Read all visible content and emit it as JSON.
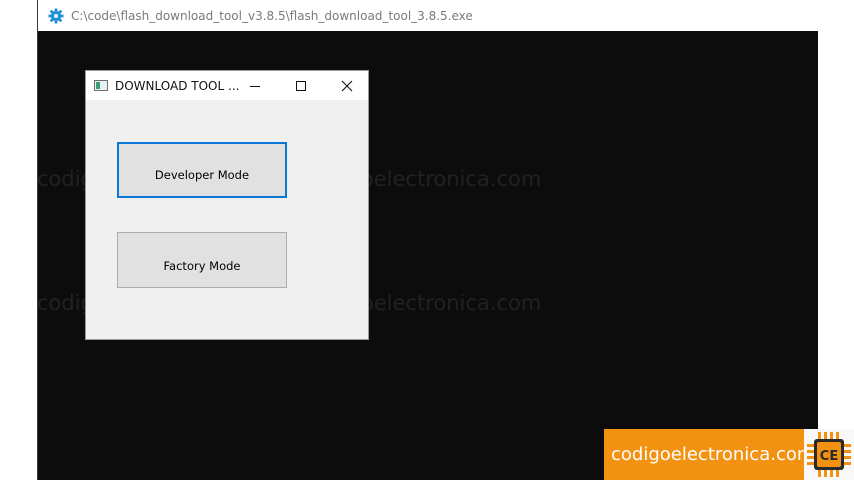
{
  "console": {
    "title": "C:\\code\\flash_download_tool_v3.8.5\\flash_download_tool_3.8.5.exe",
    "icon": "gear-icon",
    "icon_color": "#1e90d6",
    "background": "#0c0c0c"
  },
  "dialog": {
    "title": "DOWNLOAD TOOL ...",
    "minimize_icon": "minimize-icon",
    "maximize_icon": "maximize-icon",
    "close_icon": "close-icon",
    "buttons": {
      "developer": "Developer Mode",
      "factory": "Factory Mode"
    },
    "focus_color": "#0a78d7"
  },
  "watermark": {
    "text": "codigoelectronica.com"
  },
  "brand": {
    "text": "codigoelectronica.com",
    "logo_text": "CE",
    "color": "#f39110"
  }
}
